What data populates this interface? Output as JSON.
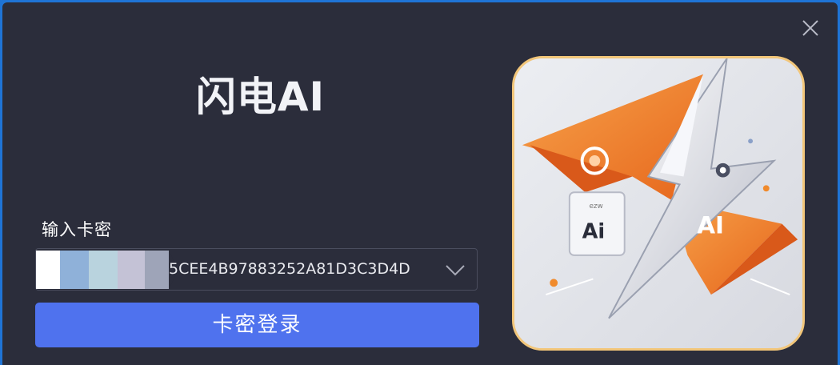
{
  "app": {
    "title": "闪电AI",
    "close_icon": "close-icon"
  },
  "form": {
    "label": "输入卡密",
    "key_value": "5CEE4B97883252A81D3C3D4D",
    "dropdown_icon": "chevron-down-icon",
    "submit_label": "卡密登录"
  },
  "logo": {
    "left_badge_text": "Ai",
    "right_text": "AI",
    "small_text": "ezw"
  },
  "colors": {
    "background": "#2b2d3b",
    "accent": "#4f72ee",
    "orange": "#f08a2c",
    "frame_gold": "#f2c67a"
  }
}
